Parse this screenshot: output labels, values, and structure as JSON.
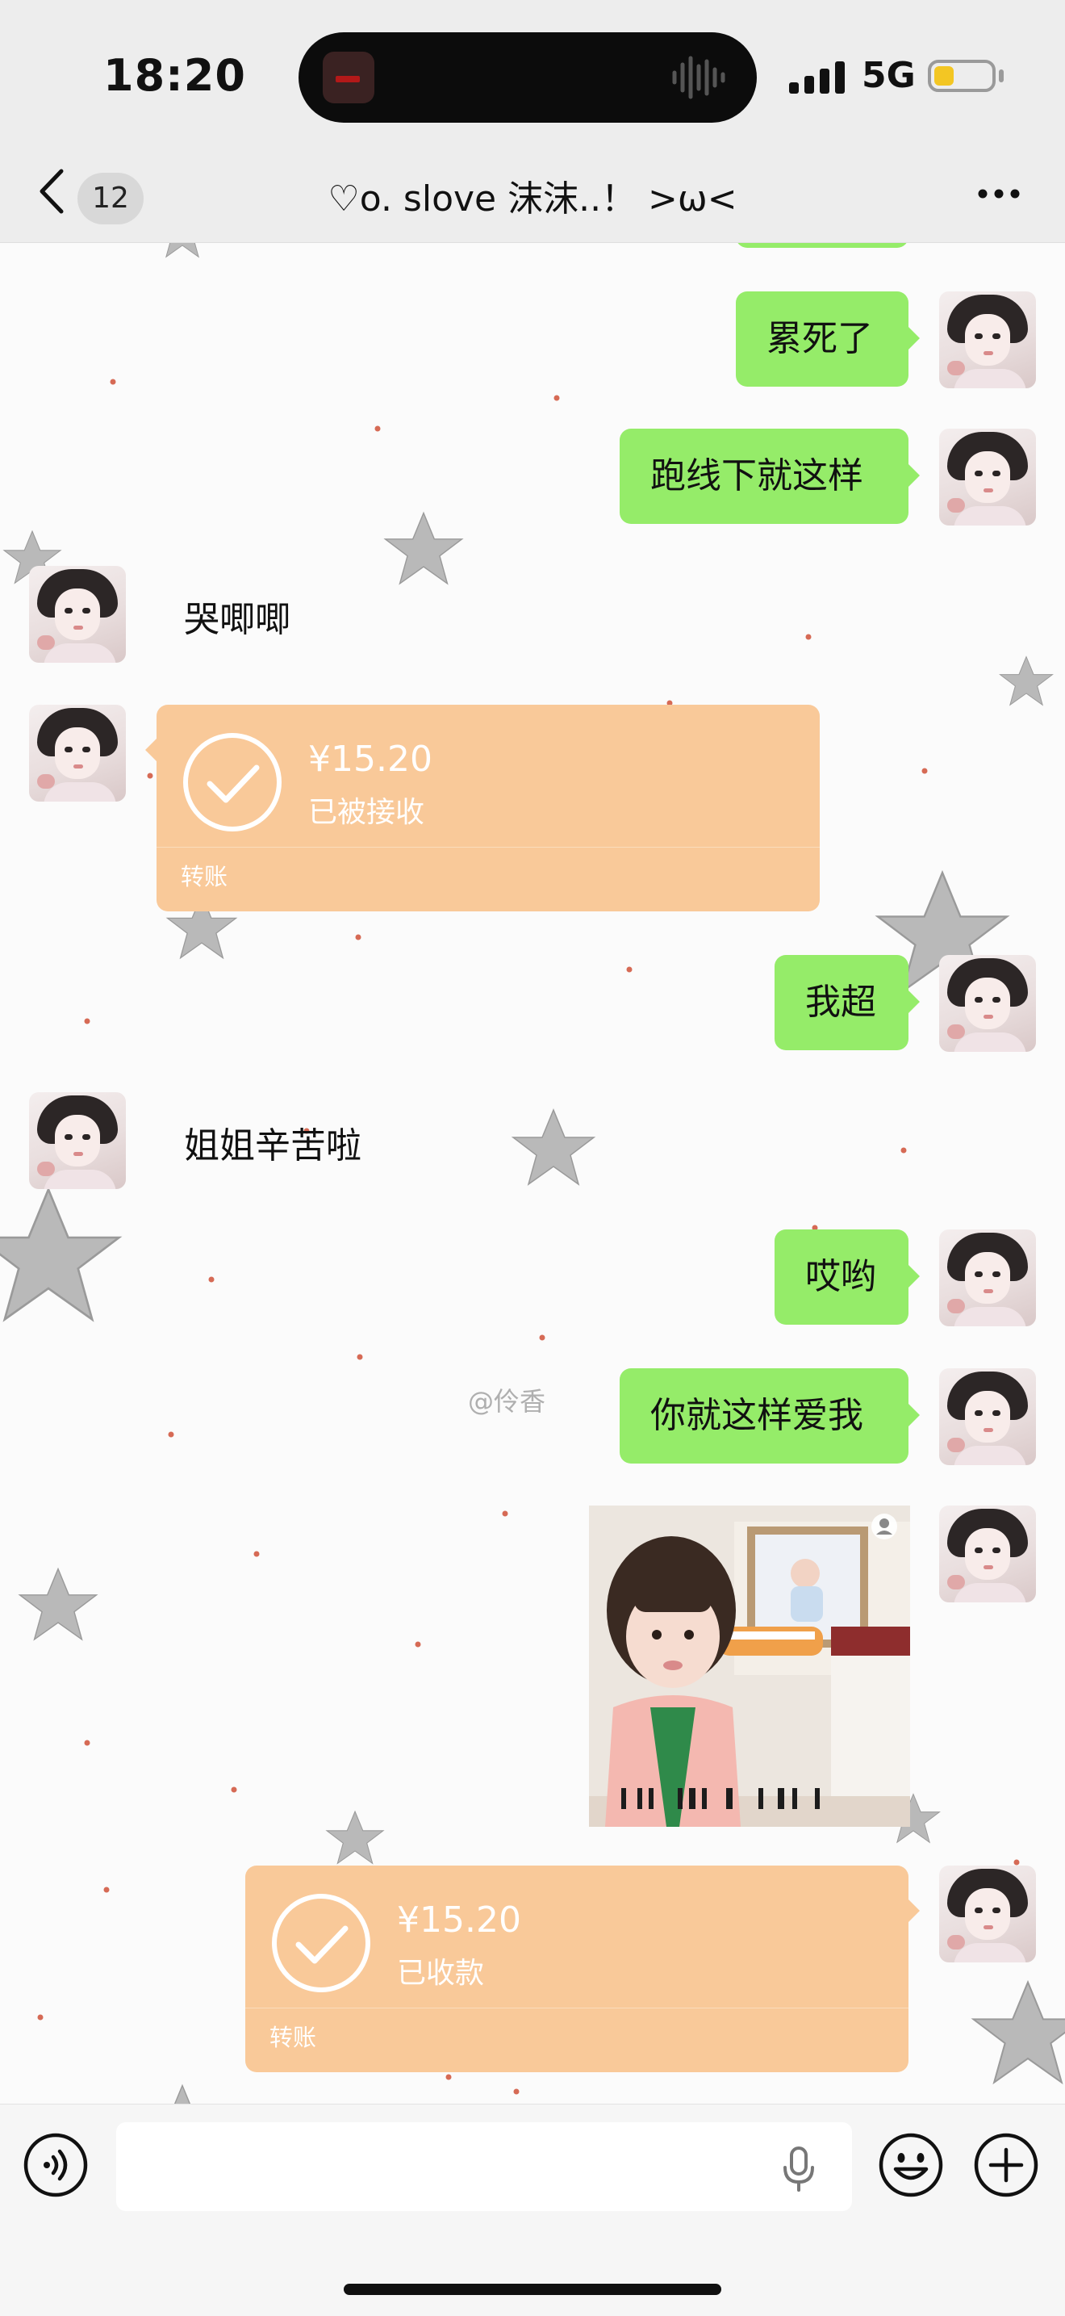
{
  "status_bar": {
    "time": "18:20",
    "network": "5G",
    "signal_icon": "cellular-signal-icon",
    "battery_icon": "battery-low-icon",
    "battery_color": "#f3c623"
  },
  "nav": {
    "back_icon": "chevron-left-icon",
    "unread_count": "12",
    "title": "♡o. slove 沫沫..！ >ω<",
    "more_icon": "more-dots-icon"
  },
  "colors": {
    "outgoing_bubble": "#95ec69",
    "transfer_card": "#f9c999",
    "chat_background": "#fbfbfb"
  },
  "messages": [
    {
      "dir": "out",
      "type": "text",
      "text": "累死了"
    },
    {
      "dir": "out",
      "type": "text",
      "text": "跑线下就这样"
    },
    {
      "dir": "in",
      "type": "text",
      "text": "哭唧唧"
    },
    {
      "dir": "in",
      "type": "transfer",
      "amount": "¥15.20",
      "status": "已被接收",
      "label": "转账"
    },
    {
      "dir": "out",
      "type": "text",
      "text": "我超"
    },
    {
      "dir": "in",
      "type": "text",
      "text": "姐姐辛苦啦"
    },
    {
      "dir": "out",
      "type": "text",
      "text": "哎哟"
    },
    {
      "dir": "out",
      "type": "text",
      "text": "你就这样爱我"
    },
    {
      "dir": "out",
      "type": "sticker",
      "icon": "sticker-toddler-image"
    },
    {
      "dir": "out",
      "type": "transfer",
      "amount": "¥15.20",
      "status": "已收款",
      "label": "转账"
    }
  ],
  "watermark": "@伶香",
  "input_bar": {
    "voice_icon": "voice-mode-icon",
    "mic_icon": "microphone-icon",
    "emoji_icon": "emoji-icon",
    "plus_icon": "plus-icon"
  }
}
